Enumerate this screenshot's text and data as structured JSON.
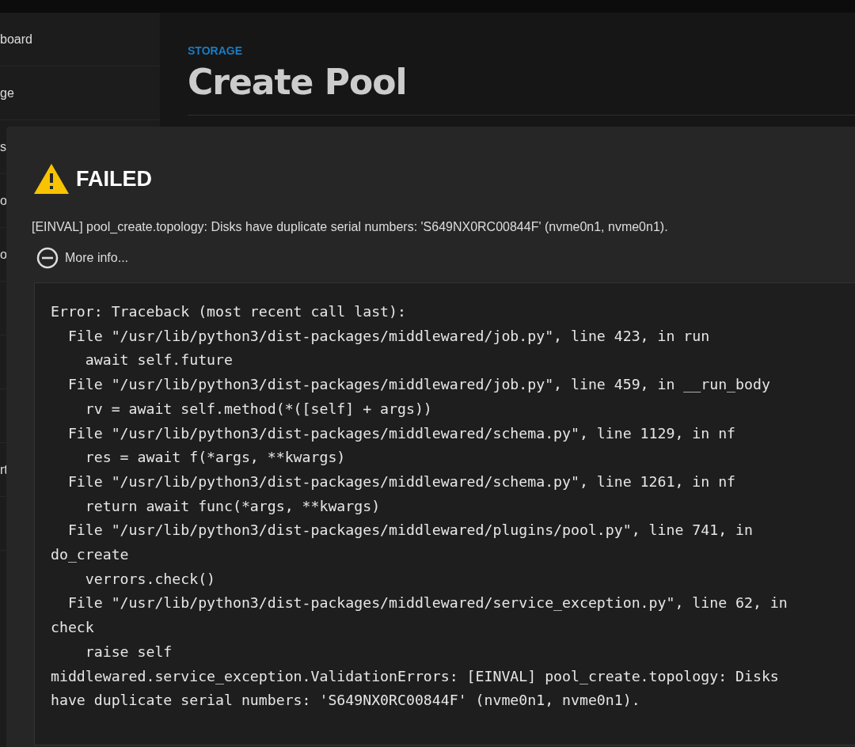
{
  "sidebar": {
    "items": [
      {
        "kind": "item",
        "label": "board"
      },
      {
        "kind": "item",
        "label": "ge"
      },
      {
        "kind": "item",
        "label": "s"
      },
      {
        "kind": "item",
        "label": "o"
      },
      {
        "kind": "item",
        "label": "o"
      },
      {
        "kind": "item"
      },
      {
        "kind": "item"
      },
      {
        "kind": "item"
      },
      {
        "kind": "item",
        "label": "rt"
      },
      {
        "kind": "item"
      }
    ]
  },
  "page": {
    "breadcrumb": "STORAGE",
    "title": "Create Pool"
  },
  "dialog": {
    "title": "FAILED",
    "message": "[EINVAL] pool_create.topology: Disks have duplicate serial numbers: 'S649NX0RC00844F' (nvme0n1, nvme0n1).",
    "more_info": {
      "label": "More info...",
      "expanded": true
    },
    "traceback": [
      "Error: Traceback (most recent call last):",
      "  File \"/usr/lib/python3/dist-packages/middlewared/job.py\", line 423, in run",
      "    await self.future",
      "  File \"/usr/lib/python3/dist-packages/middlewared/job.py\", line 459, in __run_body",
      "    rv = await self.method(*([self] + args))",
      "  File \"/usr/lib/python3/dist-packages/middlewared/schema.py\", line 1129, in nf",
      "    res = await f(*args, **kwargs)",
      "  File \"/usr/lib/python3/dist-packages/middlewared/schema.py\", line 1261, in nf",
      "    return await func(*args, **kwargs)",
      "  File \"/usr/lib/python3/dist-packages/middlewared/plugins/pool.py\", line 741, in",
      "do_create",
      "    verrors.check()",
      "  File \"/usr/lib/python3/dist-packages/middlewared/service_exception.py\", line 62, in",
      "check",
      "    raise self",
      "middlewared.service_exception.ValidationErrors: [EINVAL] pool_create.topology: Disks",
      "have duplicate serial numbers: 'S649NX0RC00844F' (nvme0n1, nvme0n1)."
    ]
  }
}
